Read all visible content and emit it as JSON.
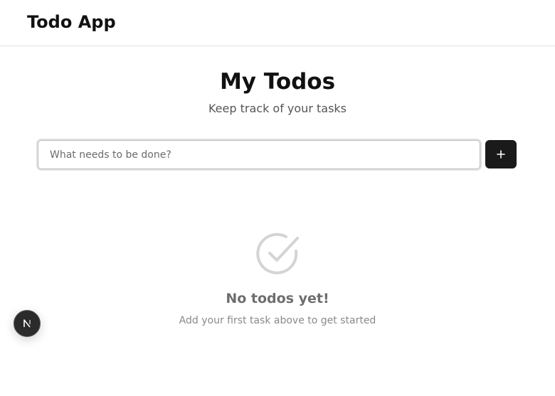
{
  "header": {
    "app_title": "Todo App"
  },
  "main": {
    "title": "My Todos",
    "subtitle": "Keep track of your tasks",
    "new_todo": {
      "value": "",
      "placeholder": "What needs to be done?",
      "add_icon": "plus-icon"
    },
    "empty_state": {
      "icon": "check-circle-icon",
      "title": "No todos yet!",
      "message": "Add your first task above to get started"
    }
  },
  "floating_badge": {
    "icon": "nextjs-logo-icon"
  },
  "colors": {
    "button_bg": "#1a1a1a",
    "muted_icon": "#d4d4d4",
    "empty_title": "#6e6e6e"
  }
}
